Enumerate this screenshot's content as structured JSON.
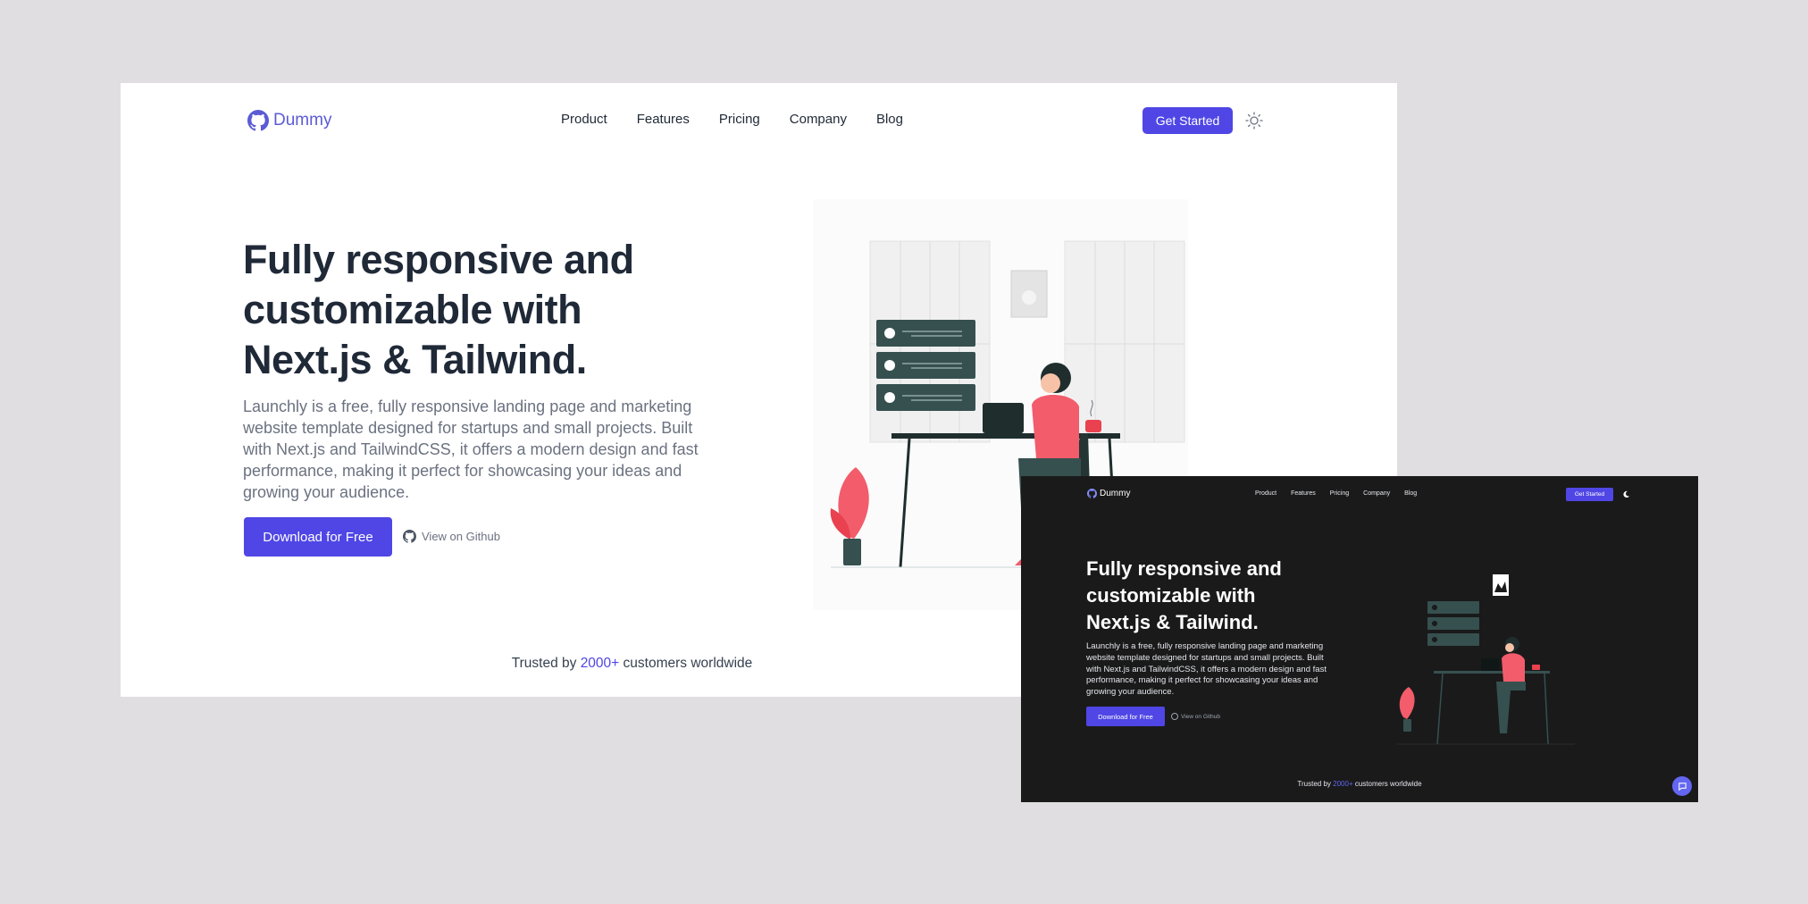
{
  "light": {
    "brand": "Dummy",
    "nav": [
      "Product",
      "Features",
      "Pricing",
      "Company",
      "Blog"
    ],
    "cta_label": "Get Started",
    "theme_icon": "sun-icon",
    "hero_title": "Fully responsive and customizable with Next.js & Tailwind.",
    "hero_description": "Launchly is a free, fully responsive landing page and marketing website template designed for startups and small projects. Built with Next.js and TailwindCSS, it offers a modern design and fast performance, making it perfect for showcasing your ideas and growing your audience.",
    "download_label": "Download for Free",
    "github_label": "View on Github",
    "trust_prefix": "Trusted by",
    "trust_count": "2000+",
    "trust_suffix": "customers worldwide"
  },
  "dark": {
    "brand": "Dummy",
    "nav": [
      "Product",
      "Features",
      "Pricing",
      "Company",
      "Blog"
    ],
    "cta_label": "Get Started",
    "theme_icon": "moon-icon",
    "hero_title": "Fully responsive and customizable with Next.js & Tailwind.",
    "hero_description": "Launchly is a free, fully responsive landing page and marketing website template designed for startups and small projects. Built with Next.js and TailwindCSS, it offers a modern design and fast performance, making it perfect for showcasing your ideas and growing your audience.",
    "download_label": "Download for Free",
    "github_label": "View on Github",
    "trust_prefix": "Trusted by",
    "trust_count": "2000+",
    "trust_suffix": "customers worldwide",
    "chat_icon": "chat-icon"
  },
  "colors": {
    "accent": "#4f46e5",
    "background": "#e0dee1",
    "dark_background": "#1a1a1b",
    "text_dark": "#1f2937"
  }
}
